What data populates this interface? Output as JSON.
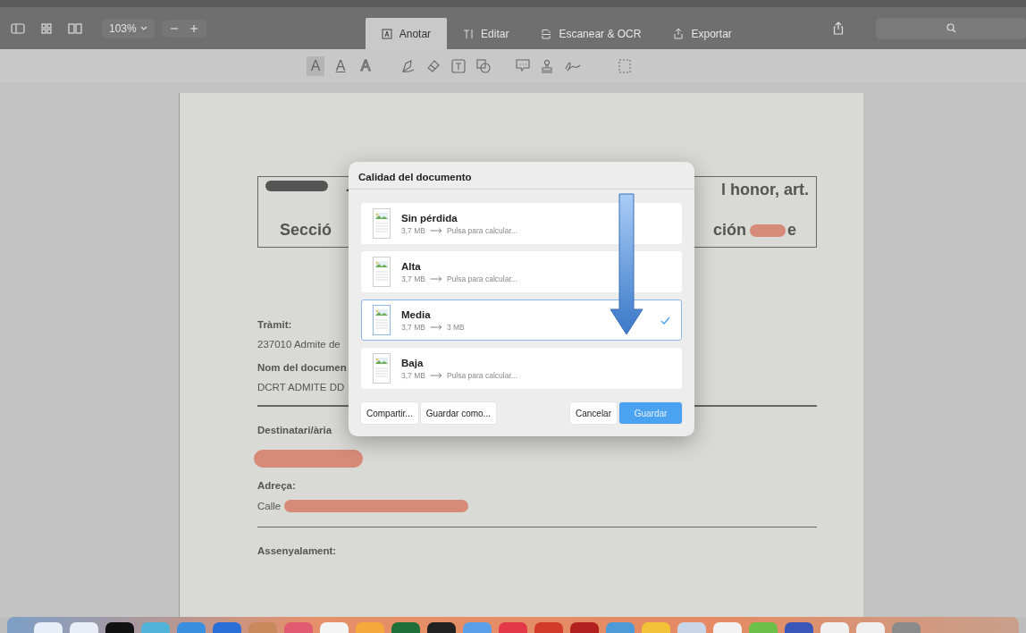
{
  "toolbar": {
    "zoom": "103%",
    "tabs": [
      {
        "label": "Anotar",
        "selected": true
      },
      {
        "label": "Editar",
        "selected": false
      },
      {
        "label": "Escanear & OCR",
        "selected": false
      },
      {
        "label": "Exportar",
        "selected": false
      }
    ]
  },
  "annotation_bar": {
    "text_styles": [
      {
        "label": "A",
        "selected": true
      },
      {
        "label": "A",
        "selected": false
      },
      {
        "label": "A",
        "selected": false
      }
    ]
  },
  "document": {
    "header_top_left": "-",
    "header_top_right": "l honor, art.",
    "header_bottom_left": "Secció",
    "header_bottom_right_start": "ción",
    "header_bottom_right_end": "e",
    "fields": [
      {
        "label": "Tràmit:",
        "value": "237010 Admite de",
        "redacted": false
      },
      {
        "label": "Nom del documen",
        "value": "DCRT ADMITE DD",
        "redacted": false
      },
      {
        "label": "Destinatari/ària",
        "redacted": true
      },
      {
        "label": "Adreça:",
        "value": "Calle",
        "redacted": true
      },
      {
        "label": "Assenyalament:",
        "redacted": false
      }
    ]
  },
  "dialog": {
    "title": "Calidad del documento",
    "options": [
      {
        "name": "Sin pérdida",
        "size_before": "3,7 MB",
        "size_after": "Pulsa para calcular...",
        "selected": false
      },
      {
        "name": "Alta",
        "size_before": "3,7 MB",
        "size_after": "Pulsa para calcular...",
        "selected": false
      },
      {
        "name": "Media",
        "size_before": "3,7 MB",
        "size_after": "3 MB",
        "selected": true
      },
      {
        "name": "Baja",
        "size_before": "3,7 MB",
        "size_after": "Pulsa para calcular...",
        "selected": false
      }
    ],
    "buttons": [
      {
        "label": "Compartir...",
        "kind": "secondary"
      },
      {
        "label": "Guardar como...",
        "kind": "secondary"
      },
      {
        "label": "Cancelar",
        "kind": "secondary"
      },
      {
        "label": "Guardar",
        "kind": "primary"
      }
    ]
  }
}
